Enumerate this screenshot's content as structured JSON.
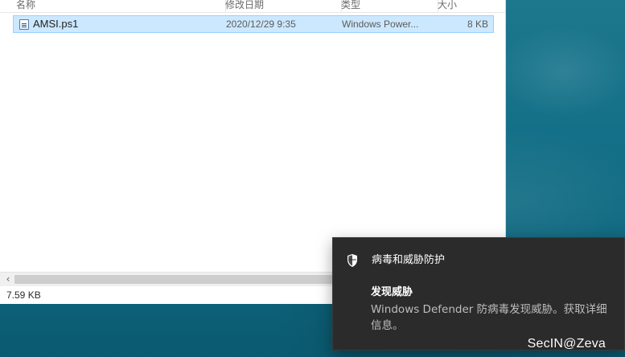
{
  "explorer": {
    "columns": {
      "name": "名称",
      "date": "修改日期",
      "type": "类型",
      "size": "大小"
    },
    "files": [
      {
        "name": "AMSI.ps1",
        "date": "2020/12/29 9:35",
        "type": "Windows Power...",
        "size": "8 KB"
      }
    ],
    "status": "7.59 KB"
  },
  "toast": {
    "app_title": "病毒和威胁防护",
    "title": "发现威胁",
    "body": "Windows Defender 防病毒发现威胁。获取详细信息。"
  },
  "watermark": "SecIN@Zeva",
  "icons": {
    "file": "powershell-script-icon",
    "scroll_left": "chevron-left-icon",
    "shield": "shield-icon"
  },
  "colors": {
    "selection": "#cce8ff",
    "toast_bg": "#2b2b2b",
    "desktop": "#0b6d86"
  }
}
